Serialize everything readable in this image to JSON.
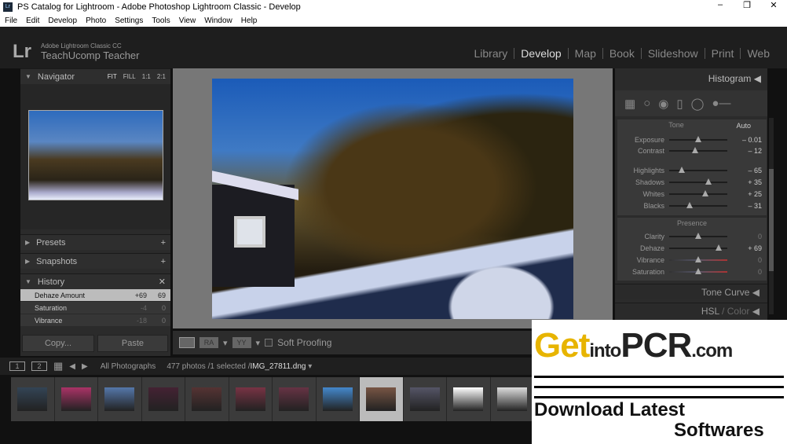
{
  "window": {
    "title": "PS Catalog for Lightroom - Adobe Photoshop Lightroom Classic - Develop",
    "app_icon": "Lr",
    "controls": [
      "–",
      "❐",
      "✕"
    ]
  },
  "menu": [
    "File",
    "Edit",
    "Develop",
    "Photo",
    "Settings",
    "Tools",
    "View",
    "Window",
    "Help"
  ],
  "identity": {
    "logo": "Lr",
    "product": "Adobe Lightroom Classic CC",
    "user": "TeachUcomp Teacher"
  },
  "modules": [
    {
      "label": "Library"
    },
    {
      "label": "Develop",
      "active": true
    },
    {
      "label": "Map"
    },
    {
      "label": "Book"
    },
    {
      "label": "Slideshow"
    },
    {
      "label": "Print"
    },
    {
      "label": "Web"
    }
  ],
  "left": {
    "navigator": {
      "title": "Navigator",
      "zoom": [
        "FIT",
        "FILL",
        "1:1",
        "2:1"
      ]
    },
    "presets": "Presets",
    "snapshots": "Snapshots",
    "history_title": "History",
    "history": [
      {
        "label": "Dehaze Amount",
        "delta": "+69",
        "value": "69",
        "selected": true
      },
      {
        "label": "Saturation",
        "delta": "-4",
        "value": "0"
      },
      {
        "label": "Vibrance",
        "delta": "-18",
        "value": "0"
      }
    ],
    "copy": "Copy...",
    "paste": "Paste"
  },
  "toolbar": {
    "ra": "RA",
    "yy": "YY",
    "soft_proofing": "Soft Proofing",
    "soft_proofing_checked": false
  },
  "right": {
    "histogram": "Histogram",
    "tone": {
      "title": "Tone",
      "auto": "Auto",
      "sliders": [
        {
          "label": "Exposure",
          "value": "– 0.01",
          "pos": 0.5
        },
        {
          "label": "Contrast",
          "value": "– 12",
          "pos": 0.44
        },
        {
          "label": "Highlights",
          "value": "– 65",
          "pos": 0.22
        },
        {
          "label": "Shadows",
          "value": "+ 35",
          "pos": 0.67
        },
        {
          "label": "Whites",
          "value": "+ 25",
          "pos": 0.62
        },
        {
          "label": "Blacks",
          "value": "– 31",
          "pos": 0.35
        }
      ]
    },
    "presence": {
      "title": "Presence",
      "sliders": [
        {
          "label": "Clarity",
          "value": "0",
          "pos": 0.5
        },
        {
          "label": "Dehaze",
          "value": "+ 69",
          "pos": 0.85
        },
        {
          "label": "Vibrance",
          "value": "0",
          "pos": 0.5
        },
        {
          "label": "Saturation",
          "value": "0",
          "pos": 0.5
        }
      ]
    },
    "tone_curve": "Tone Curve",
    "hsl": "HSL",
    "color": "Color"
  },
  "filmstrip": {
    "view1": "1",
    "view2": "2",
    "source": "All Photographs",
    "info": "477 photos /1 selected /",
    "filename": "IMG_27811.dng",
    "selected_index": 8,
    "count": 12
  },
  "watermark": {
    "get": "Get",
    "into": "into",
    "pc": "PC",
    "r": "R",
    "com": ".com",
    "line1": "Download Latest",
    "line2": "Softwares"
  }
}
